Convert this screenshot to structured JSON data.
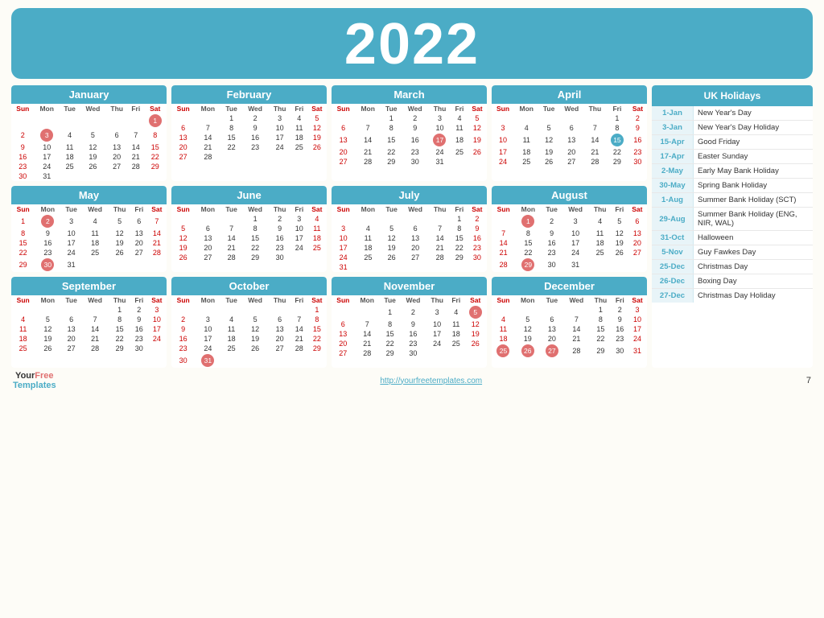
{
  "title": "2022",
  "months": [
    {
      "name": "January",
      "weeks": [
        [
          "",
          "",
          "",
          "",
          "",
          "",
          "1"
        ],
        [
          "2",
          "3",
          "4",
          "5",
          "6",
          "7",
          "8"
        ],
        [
          "9",
          "10",
          "11",
          "12",
          "13",
          "14",
          "15"
        ],
        [
          "16",
          "17",
          "18",
          "19",
          "20",
          "21",
          "22"
        ],
        [
          "23",
          "24",
          "25",
          "26",
          "27",
          "28",
          "29"
        ],
        [
          "30",
          "31",
          "",
          "",
          "",
          "",
          ""
        ]
      ],
      "circles": {
        "3": "red",
        "1": "red-sat"
      }
    },
    {
      "name": "February",
      "weeks": [
        [
          "",
          "",
          "1",
          "2",
          "3",
          "4",
          "5"
        ],
        [
          "6",
          "7",
          "8",
          "9",
          "10",
          "11",
          "12"
        ],
        [
          "13",
          "14",
          "15",
          "16",
          "17",
          "18",
          "19"
        ],
        [
          "20",
          "21",
          "22",
          "23",
          "24",
          "25",
          "26"
        ],
        [
          "27",
          "28",
          "",
          "",
          "",
          "",
          ""
        ]
      ]
    },
    {
      "name": "March",
      "weeks": [
        [
          "",
          "",
          "1",
          "2",
          "3",
          "4",
          "5"
        ],
        [
          "6",
          "7",
          "8",
          "9",
          "10",
          "11",
          "12"
        ],
        [
          "13",
          "14",
          "15",
          "16",
          "17",
          "18",
          "19"
        ],
        [
          "20",
          "21",
          "22",
          "23",
          "24",
          "25",
          "26"
        ],
        [
          "27",
          "28",
          "29",
          "30",
          "31",
          "",
          ""
        ]
      ],
      "circles": {
        "17": "red"
      }
    },
    {
      "name": "April",
      "weeks": [
        [
          "",
          "",
          "",
          "",
          "",
          "1",
          "2"
        ],
        [
          "3",
          "4",
          "5",
          "6",
          "7",
          "8",
          "9"
        ],
        [
          "10",
          "11",
          "12",
          "13",
          "14",
          "15",
          "16"
        ],
        [
          "17",
          "18",
          "19",
          "20",
          "21",
          "22",
          "23"
        ],
        [
          "24",
          "25",
          "26",
          "27",
          "28",
          "29",
          "30"
        ]
      ],
      "circles": {
        "15": "blue"
      }
    },
    {
      "name": "May",
      "weeks": [
        [
          "1",
          "2",
          "3",
          "4",
          "5",
          "6",
          "7"
        ],
        [
          "8",
          "9",
          "10",
          "11",
          "12",
          "13",
          "14"
        ],
        [
          "15",
          "16",
          "17",
          "18",
          "19",
          "20",
          "21"
        ],
        [
          "22",
          "23",
          "24",
          "25",
          "26",
          "27",
          "28"
        ],
        [
          "29",
          "30",
          "31",
          "",
          "",
          "",
          ""
        ]
      ],
      "circles": {
        "2": "red",
        "30": "red"
      }
    },
    {
      "name": "June",
      "weeks": [
        [
          "",
          "",
          "",
          "1",
          "2",
          "3",
          "4"
        ],
        [
          "5",
          "6",
          "7",
          "8",
          "9",
          "10",
          "11"
        ],
        [
          "12",
          "13",
          "14",
          "15",
          "16",
          "17",
          "18"
        ],
        [
          "19",
          "20",
          "21",
          "22",
          "23",
          "24",
          "25"
        ],
        [
          "26",
          "27",
          "28",
          "29",
          "30",
          "",
          ""
        ]
      ]
    },
    {
      "name": "July",
      "weeks": [
        [
          "",
          "",
          "",
          "",
          "",
          "1",
          "2"
        ],
        [
          "3",
          "4",
          "5",
          "6",
          "7",
          "8",
          "9"
        ],
        [
          "10",
          "11",
          "12",
          "13",
          "14",
          "15",
          "16"
        ],
        [
          "17",
          "18",
          "19",
          "20",
          "21",
          "22",
          "23"
        ],
        [
          "24",
          "25",
          "26",
          "27",
          "28",
          "29",
          "30"
        ],
        [
          "31",
          "",
          "",
          "",
          "",
          "",
          ""
        ]
      ]
    },
    {
      "name": "August",
      "weeks": [
        [
          "",
          "1",
          "2",
          "3",
          "4",
          "5",
          "6"
        ],
        [
          "7",
          "8",
          "9",
          "10",
          "11",
          "12",
          "13"
        ],
        [
          "14",
          "15",
          "16",
          "17",
          "18",
          "19",
          "20"
        ],
        [
          "21",
          "22",
          "23",
          "24",
          "25",
          "26",
          "27"
        ],
        [
          "28",
          "29",
          "30",
          "31",
          "",
          "",
          ""
        ]
      ],
      "circles": {
        "1": "red",
        "29": "red"
      }
    },
    {
      "name": "September",
      "weeks": [
        [
          "",
          "",
          "",
          "",
          "1",
          "2",
          "3"
        ],
        [
          "4",
          "5",
          "6",
          "7",
          "8",
          "9",
          "10"
        ],
        [
          "11",
          "12",
          "13",
          "14",
          "15",
          "16",
          "17"
        ],
        [
          "18",
          "19",
          "20",
          "21",
          "22",
          "23",
          "24"
        ],
        [
          "25",
          "26",
          "27",
          "28",
          "29",
          "30",
          ""
        ]
      ]
    },
    {
      "name": "October",
      "weeks": [
        [
          "",
          "",
          "",
          "",
          "",
          "",
          "1"
        ],
        [
          "2",
          "3",
          "4",
          "5",
          "6",
          "7",
          "8"
        ],
        [
          "9",
          "10",
          "11",
          "12",
          "13",
          "14",
          "15"
        ],
        [
          "16",
          "17",
          "18",
          "19",
          "20",
          "21",
          "22"
        ],
        [
          "23",
          "24",
          "25",
          "26",
          "27",
          "28",
          "29"
        ],
        [
          "30",
          "31",
          "",
          "",
          "",
          "",
          ""
        ]
      ],
      "circles": {
        "31": "red"
      }
    },
    {
      "name": "November",
      "weeks": [
        [
          "",
          "",
          "1",
          "2",
          "3",
          "4",
          "5"
        ],
        [
          "6",
          "7",
          "8",
          "9",
          "10",
          "11",
          "12"
        ],
        [
          "13",
          "14",
          "15",
          "16",
          "17",
          "18",
          "19"
        ],
        [
          "20",
          "21",
          "22",
          "23",
          "24",
          "25",
          "26"
        ],
        [
          "27",
          "28",
          "29",
          "30",
          "",
          "",
          ""
        ]
      ],
      "circles": {
        "5": "red"
      }
    },
    {
      "name": "December",
      "weeks": [
        [
          "",
          "",
          "",
          "",
          "1",
          "2",
          "3"
        ],
        [
          "4",
          "5",
          "6",
          "7",
          "8",
          "9",
          "10"
        ],
        [
          "11",
          "12",
          "13",
          "14",
          "15",
          "16",
          "17"
        ],
        [
          "18",
          "19",
          "20",
          "21",
          "22",
          "23",
          "24"
        ],
        [
          "25",
          "26",
          "27",
          "28",
          "29",
          "30",
          "31"
        ]
      ],
      "circles": {
        "25": "red",
        "26": "red",
        "27": "red"
      }
    }
  ],
  "holidays": {
    "header": "UK Holidays",
    "items": [
      {
        "date": "1-Jan",
        "name": "New Year's Day"
      },
      {
        "date": "3-Jan",
        "name": "New Year's Day Holiday"
      },
      {
        "date": "15-Apr",
        "name": "Good Friday"
      },
      {
        "date": "17-Apr",
        "name": "Easter Sunday"
      },
      {
        "date": "2-May",
        "name": "Early May Bank Holiday"
      },
      {
        "date": "30-May",
        "name": "Spring Bank Holiday"
      },
      {
        "date": "1-Aug",
        "name": "Summer Bank Holiday (SCT)"
      },
      {
        "date": "29-Aug",
        "name": "Summer Bank Holiday (ENG, NIR, WAL)"
      },
      {
        "date": "31-Oct",
        "name": "Halloween"
      },
      {
        "date": "5-Nov",
        "name": "Guy Fawkes Day"
      },
      {
        "date": "25-Dec",
        "name": "Christmas Day"
      },
      {
        "date": "26-Dec",
        "name": "Boxing Day"
      },
      {
        "date": "27-Dec",
        "name": "Christmas Day Holiday"
      }
    ]
  },
  "footer": {
    "logo_your": "Your",
    "logo_free": "Free",
    "logo_templates": "Templates",
    "url": "http://yourfreetemplates.com",
    "page": "7"
  },
  "days_header": [
    "Sun",
    "Mon",
    "Tue",
    "Wed",
    "Thu",
    "Fri",
    "Sat"
  ]
}
